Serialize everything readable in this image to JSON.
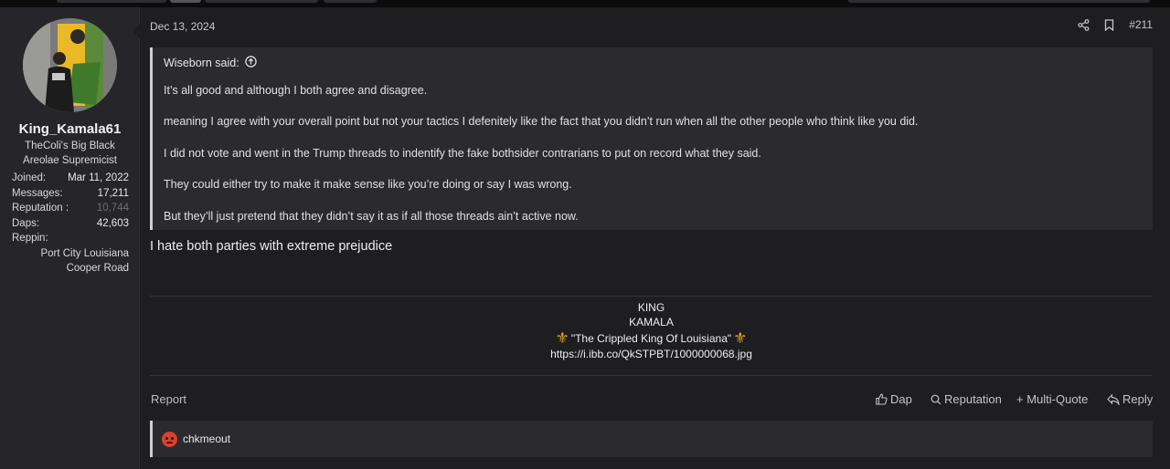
{
  "user": {
    "name": "King_Kamala61",
    "title_line1": "TheColi's Big Black",
    "title_line2": "Areolae Supremicist",
    "stats": [
      {
        "label": "Joined:",
        "value": "Mar 11, 2022"
      },
      {
        "label": "Messages:",
        "value": "17,211"
      },
      {
        "label": "Reputation :",
        "value": "10,744"
      },
      {
        "label": "Daps:",
        "value": "42,603"
      }
    ],
    "reppin_label": "Reppin:",
    "reppin_line1": "Port City Louisiana",
    "reppin_line2": "Cooper Road"
  },
  "post": {
    "date": "Dec 13, 2024",
    "number": "#211",
    "quote": {
      "author": "Wiseborn said:",
      "lines": [
        "It’s all good and although I both agree and disagree.",
        "meaning I agree with your overall point but not your tactics I defenitely like the fact that you didn’t run when all the other people who think like you did.",
        "I did not vote and went in the Trump threads to indentify the fake bothsider contrarians to put on record what they said.",
        "They could either try to make it make sense like you’re doing or say I was wrong.",
        "But they’ll just pretend that they didn’t say it as if all those threads ain’t active now."
      ]
    },
    "body": "I hate both parties with extreme prejudice",
    "signature": {
      "line1": "KING",
      "line2": "KAMALA",
      "line3": "\"The Crippled King Of Louisiana\"",
      "line4": "https://i.ibb.co/QkSTPBT/1000000068.jpg"
    }
  },
  "footer": {
    "report": "Report",
    "dap": "Dap",
    "reputation": "Reputation",
    "multiquote": "+ Multi-Quote",
    "reply": "Reply"
  },
  "reactions": {
    "user": "chkmeout"
  },
  "colors": {
    "background": "#1e1d20",
    "sidebar": "#26252a",
    "quote_bg": "#2b2a2f",
    "fleur": "#d9a72a"
  }
}
